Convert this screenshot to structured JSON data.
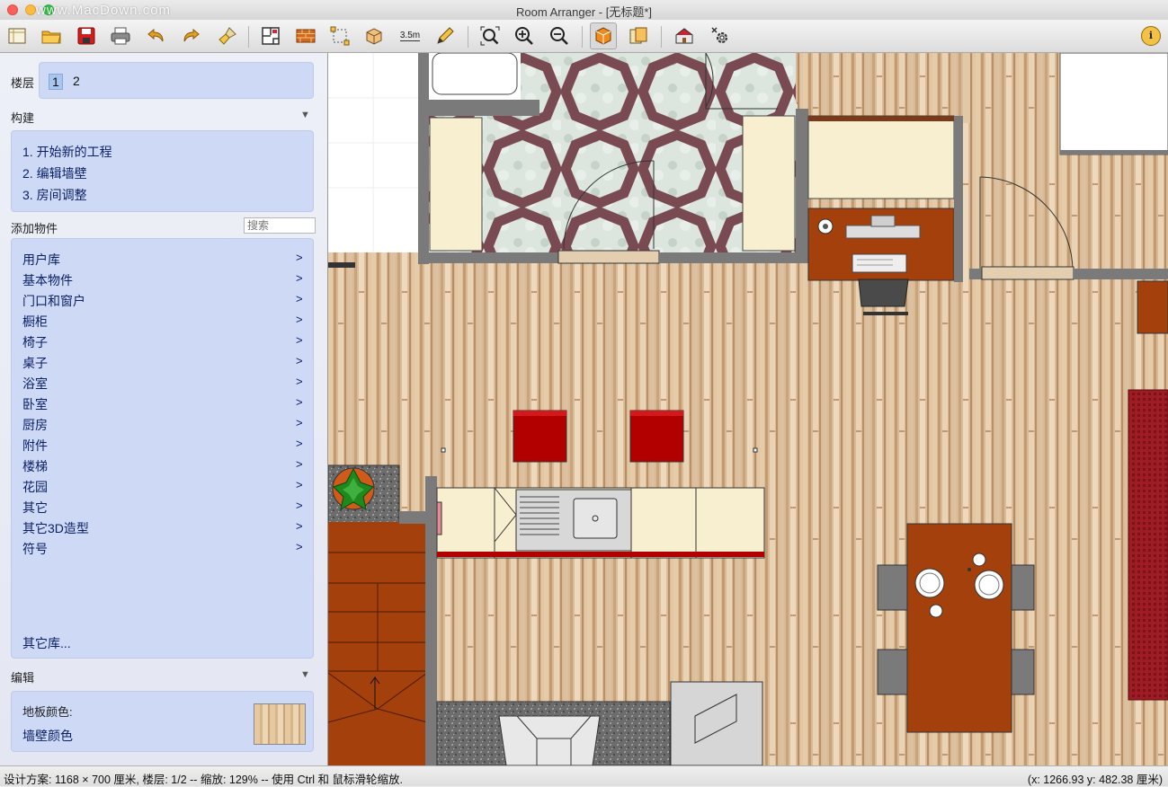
{
  "window": {
    "title": "Room Arranger - [无标题*]",
    "watermark": "www.MacDown.com"
  },
  "toolbar": {
    "icons": [
      "new-file",
      "open-folder",
      "save",
      "print",
      "undo",
      "redo",
      "brush",
      "floor-plan",
      "wall-brick",
      "select",
      "move-3d",
      "measure",
      "pencil",
      "zoom-fit",
      "zoom-in",
      "zoom-out",
      "view-3d",
      "view-objects",
      "house-3d",
      "settings-gear",
      "info"
    ],
    "measure_label": "3.5m",
    "info_label": "i"
  },
  "sidebar": {
    "floors": {
      "label": "楼层",
      "items": [
        "1",
        "2"
      ],
      "selected": "1"
    },
    "build": {
      "label": "构建",
      "steps": [
        "1. 开始新的工程",
        "2. 编辑墙壁",
        "3. 房间调整"
      ]
    },
    "add_objects": {
      "label": "添加物件",
      "search_placeholder": "搜索",
      "categories": [
        "用户库",
        "基本物件",
        "门口和窗户",
        "橱柜",
        "椅子",
        "桌子",
        "浴室",
        "卧室",
        "厨房",
        "附件",
        "楼梯",
        "花园",
        "其它",
        "其它3D造型",
        "符号"
      ],
      "chevron": ">",
      "more": "其它库..."
    },
    "edit": {
      "label": "编辑",
      "floor_color": "地板颜色:",
      "wall_color": "墙壁颜色"
    }
  },
  "status": {
    "left": "设计方案: 1168 × 700 厘米, 楼层: 1/2 -- 缩放: 129% -- 使用 Ctrl 和 鼠标滑轮缩放.",
    "right": "(x: 1266.93 y: 482.38 厘米)"
  },
  "colors": {
    "wall": "#7a7a7a",
    "wood_floor": "#d8b893",
    "cabinet": "#f7efcf",
    "wood_table": "#a4400c",
    "red_chair": "#b20000",
    "rug": "#9a1a22",
    "panel": "#cdd9f5",
    "link_text": "#0a1f66"
  }
}
